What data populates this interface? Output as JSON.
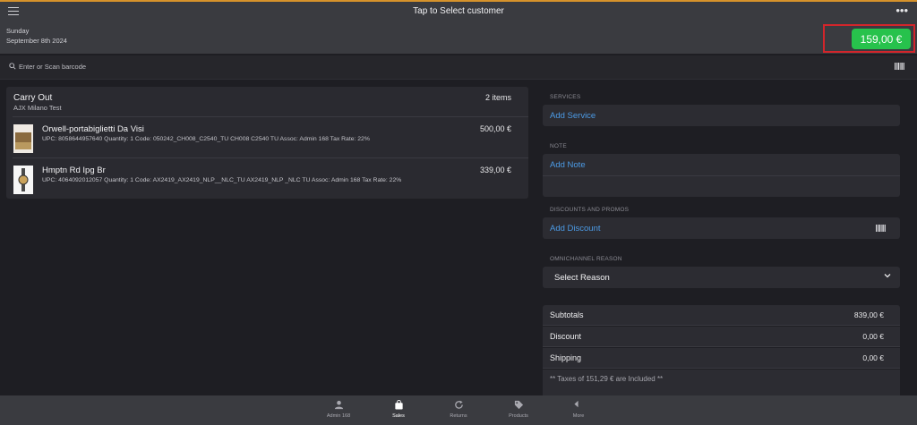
{
  "header": {
    "title": "Tap to Select customer",
    "day": "Sunday",
    "date": "September 8th 2024",
    "total_button": "159,00 €"
  },
  "search": {
    "placeholder": "Enter or Scan barcode"
  },
  "cart": {
    "mode": "Carry Out",
    "store": "AJX Milano Test",
    "count": "2 items",
    "items": [
      {
        "name": "Orwell-portabiglietti Da Visi",
        "detail": "UPC: 8058644957640 Quantity: 1 Code: 050242_CH008_C2540_TU CH008 C2540 TU Assoc: Admin 168 Tax Rate: 22%",
        "price": "500,00 €"
      },
      {
        "name": "Hmptn Rd Ipg Br",
        "detail": "UPC: 4064092012057 Quantity: 1 Code: AX2419_AX2419_NLP__NLC_TU AX2419_NLP _NLC TU Assoc: Admin 168 Tax Rate: 22%",
        "price": "339,00 €"
      }
    ]
  },
  "services": {
    "label": "SERVICES",
    "add": "Add Service"
  },
  "note": {
    "label": "NOTE",
    "add": "Add Note"
  },
  "discounts": {
    "label": "DISCOUNTS AND PROMOS",
    "add": "Add Discount"
  },
  "omnichannel": {
    "label": "OMNICHANNEL REASON",
    "select": "Select Reason"
  },
  "summary": {
    "subtotal_label": "Subtotals",
    "subtotal": "839,00 €",
    "discount_label": "Discount",
    "discount": "0,00 €",
    "shipping_label": "Shipping",
    "shipping": "0,00 €",
    "tax_note": "** Taxes of 151,29 € are Included **"
  },
  "nav": [
    {
      "label": "Admin 168",
      "icon": "user-icon"
    },
    {
      "label": "Sales",
      "icon": "shopping-bag-icon"
    },
    {
      "label": "Returns",
      "icon": "refresh-icon"
    },
    {
      "label": "Products",
      "icon": "tags-icon"
    },
    {
      "label": "More",
      "icon": "reply-icon"
    }
  ],
  "colors": {
    "accent": "#4c9be6",
    "total": "#27c24c",
    "highlight": "#d2252b",
    "top_border": "#d6922b"
  }
}
